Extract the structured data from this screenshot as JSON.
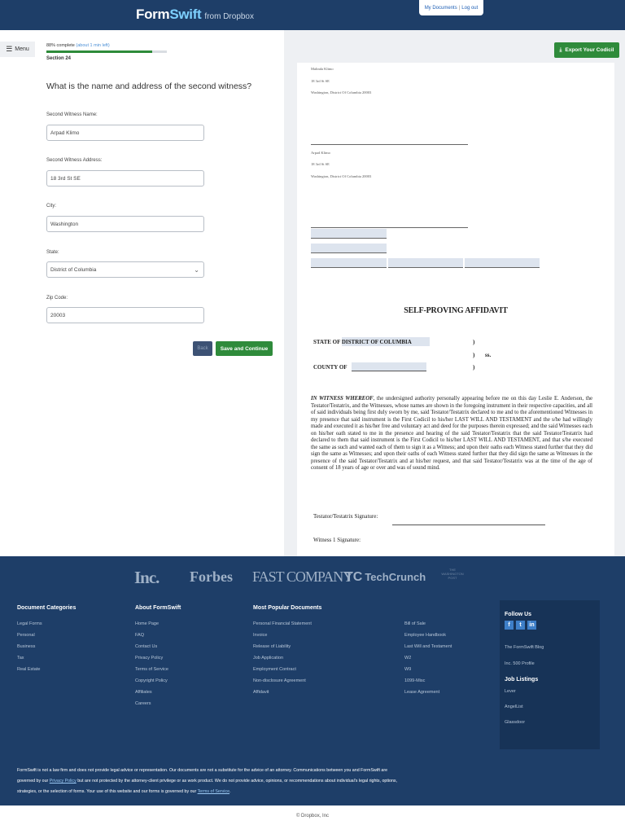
{
  "header": {
    "logo_main_a": "Form",
    "logo_main_b": "Swift",
    "logo_sub": "from Dropbox",
    "my_documents": "My Documents",
    "separator": "|",
    "logout": "Log out"
  },
  "form": {
    "menu_label": "Menu",
    "progress_pct_label": "88% complete",
    "progress_time": "(about 1 min left)",
    "progress_value": 0.88,
    "section": "Section 24",
    "question": "What is the name and address of the second witness?",
    "fields": [
      {
        "label": "Second Witness Name:",
        "value": "Arpad Klimo"
      },
      {
        "label": "Second Witness Address:",
        "value": "18 3rd St SE"
      },
      {
        "label": "City:",
        "value": "Washington"
      },
      {
        "label": "State:",
        "value": "District of Columbia"
      },
      {
        "label": "Zip Code:",
        "value": "20003"
      }
    ],
    "back_label": "Back",
    "save_label": "Save and Continue"
  },
  "preview": {
    "export_label": "Export Your Codicil",
    "witness1": [
      "Malinda Klimo",
      "18 3rd St SE",
      "Washington, District Of Columbia 20003"
    ],
    "witness2": [
      "Arpad Klimo",
      "18 3rd St SE",
      "Washington, District Of Columbia 20003"
    ],
    "affidavit_title": "SELF-PROVING AFFIDAVIT",
    "state_line": "STATE OF DISTRICT OF COLUMBIA",
    "county_line": "COUNTY OF",
    "paren": ")",
    "ss": "ss.",
    "body_lead": "IN WITNESS WHEREOF",
    "body_text": ", the undersigned authority personally appearing before me on this day Leslie E. Anderson, the Testator/Testatrix, and the Witnesses, whose names are shown in the foregoing instrument in their respective capacities, and all of said individuals being first duly sworn by me, said Testator/Testatrix declared to me and to the aforementioned Witnesses in my presence that said instrument is the First Codicil to his/her LAST WILL AND TESTAMENT and the s/he had willingly made and executed it as his/her free and voluntary act and deed for the purposes therein expressed; and the said Witnesses each on his/her oath stated to me in the presence and hearing of the said Testator/Testatrix that the said Testator/Testatrix had declared to them that said instrument is the First Codicil to his/her LAST WILL AND TESTAMENT, and that s/he executed the same as such and wanted each of them to sign it as a Witness; and upon their oaths each Witness stated further that they did sign the same as Witnesses; and upon their oaths of each Witness stated further that they did sign the same as Witnesses in the presence of the said Testator/Testatrix and at his/her request, and that said Testator/Testatrix was at the time of the age of consent of 18 years of age or over and was of sound mind.",
    "testator_sig": "Testator/Testatrix Signature:",
    "witness1_sig": "Witness 1 Signature:"
  },
  "footer": {
    "press": {
      "inc": "Inc.",
      "forbes": "Forbes",
      "fastco": "FAST COMPANY",
      "tc_mark": "TC",
      "tc": "TechCrunch",
      "wp": "THE WASHINGTON POST"
    },
    "categories": {
      "title": "Document Categories",
      "links": [
        "Legal Forms",
        "Personal",
        "Business",
        "Tax",
        "Real Estate"
      ]
    },
    "about": {
      "title": "About FormSwift",
      "links": [
        "Home Page",
        "FAQ",
        "Contact Us",
        "Privacy Policy",
        "Terms of Service",
        "Copyright Policy",
        "Affiliates",
        "Careers"
      ]
    },
    "popular": {
      "title": "Most Popular Documents",
      "links": [
        "Personal Financial Statement",
        "Invoice",
        "Release of Liability",
        "Job Application",
        "Employment Contract",
        "Non-disclosure Agreement",
        "Affidavit"
      ]
    },
    "popular2": {
      "links": [
        "Bill of Sale",
        "Employee Handbook",
        "Last Will and Testament",
        "W2",
        "W9",
        "1099-Misc",
        "Lease Agreement"
      ]
    },
    "follow": {
      "title": "Follow Us",
      "social": [
        "f",
        "t",
        "in"
      ],
      "links": [
        "The FormSwift Blog",
        "Inc. 500 Profile"
      ]
    },
    "jobs": {
      "title": "Job Listings",
      "links": [
        "Lever",
        "AngelList",
        "Glassdoor"
      ]
    },
    "legal_a": "FormSwift is not a law firm and does not provide legal advice or representation. Our documents are not a substitute for the advice of an attorney. Communications between you and FormSwift are governed by our ",
    "privacy_link": "Privacy Policy",
    "legal_b": " but are not protected by the attorney-client privilege or as work product. We do not provide advice, opinions, or recommendations about individual's legal rights, options, strategies, or the selection of forms. Your use of this website and our forms is governed by our ",
    "terms_link": "Terms of Service",
    "legal_c": "."
  },
  "copyright": "© Dropbox, Inc"
}
